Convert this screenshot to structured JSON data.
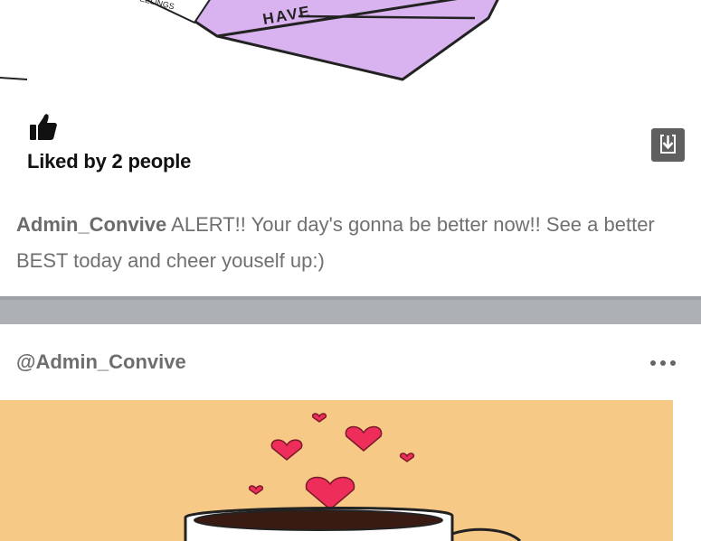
{
  "post1": {
    "image_text": "HAVE",
    "image_small_text": "FEELINGS",
    "likes_label": "Liked by 2 people",
    "caption_author": "Admin_Convive",
    "caption_text": " ALERT!! Your day's gonna be better now!! See a better BEST today and cheer youself up:)"
  },
  "post2": {
    "handle": "@Admin_Convive"
  },
  "colors": {
    "page_bg": "#adb0b5",
    "card_bg": "#ffffff",
    "envelope": "#d9b3f0",
    "post_image_bg": "#f6c986",
    "heart": "#ee2d5a",
    "download_button": "#5f5f5f"
  },
  "icons": {
    "like": "thumbs-up-icon",
    "download": "download-icon",
    "more": "more-options-icon"
  }
}
